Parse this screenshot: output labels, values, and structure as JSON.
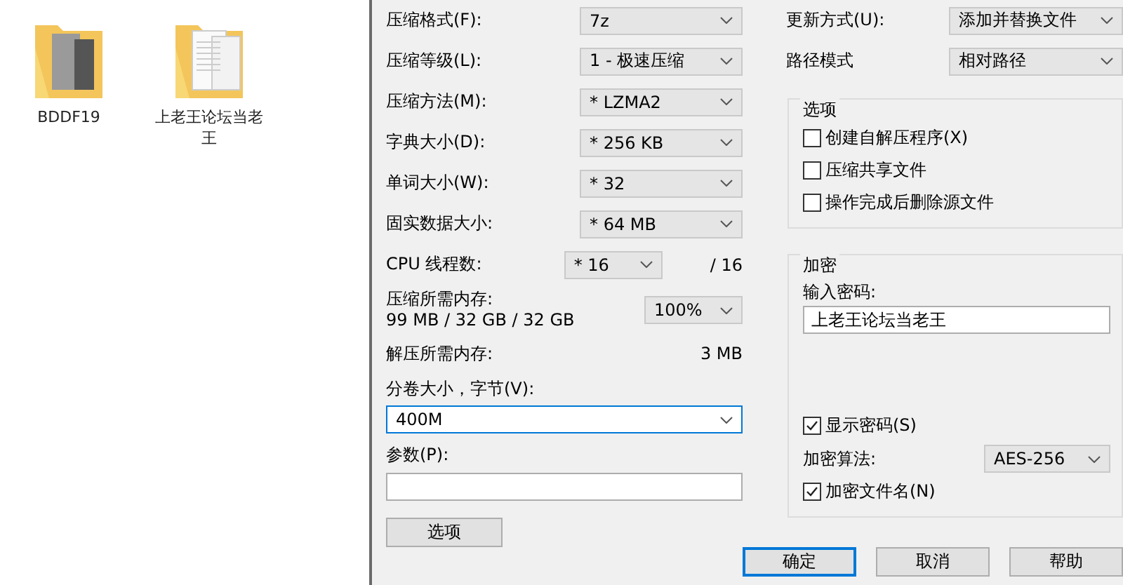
{
  "desktop": {
    "icons": [
      {
        "label": "BDDF19",
        "kind": "photos"
      },
      {
        "label": "上老王论坛当老王",
        "kind": "documents"
      }
    ]
  },
  "dialog": {
    "compression": [
      {
        "label": "压缩格式(F):",
        "value": "7z"
      },
      {
        "label": "压缩等级(L):",
        "value": "1 - 极速压缩"
      },
      {
        "label": "压缩方法(M):",
        "value": "* LZMA2"
      },
      {
        "label": "字典大小(D):",
        "value": "* 256 KB"
      },
      {
        "label": "单词大小(W):",
        "value": "* 32"
      },
      {
        "label": "固实数据大小:",
        "value": "* 64 MB"
      }
    ],
    "threads": {
      "label": "CPU 线程数:",
      "value": "* 16",
      "total": "/ 16"
    },
    "memory": {
      "label": "压缩所需内存:",
      "usage": "99 MB / 32 GB / 32 GB",
      "value": "100%"
    },
    "decompress_memory": {
      "label": "解压所需内存:",
      "value": "3 MB"
    },
    "volume_size": {
      "label": "分卷大小，字节(V):",
      "value": "400M"
    },
    "parameters": {
      "label": "参数(P):"
    },
    "options_button": "选项",
    "update_mode": {
      "label": "更新方式(U):",
      "value": "添加并替换文件"
    },
    "path_mode": {
      "label": "路径模式",
      "value": "相对路径"
    },
    "options_group": {
      "title": "选项",
      "items": [
        {
          "label": "创建自解压程序(X)",
          "checked": false
        },
        {
          "label": "压缩共享文件",
          "checked": false
        },
        {
          "label": "操作完成后删除源文件",
          "checked": false
        }
      ]
    },
    "encryption": {
      "title": "加密",
      "password_label": "输入密码:",
      "password": "上老王论坛当老王",
      "show_password": {
        "label": "显示密码(S)",
        "checked": true
      },
      "method_label": "加密算法:",
      "method": "AES-256",
      "encrypt_names": {
        "label": "加密文件名(N)",
        "checked": true
      }
    },
    "buttons": [
      {
        "label": "确定",
        "default": true
      },
      {
        "label": "取消",
        "default": false
      },
      {
        "label": "帮助",
        "default": false
      }
    ]
  }
}
